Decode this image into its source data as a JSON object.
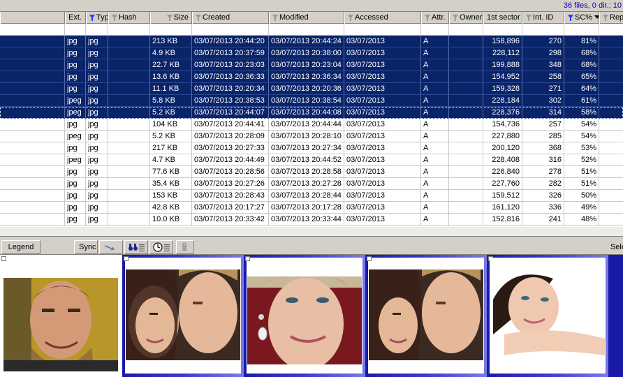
{
  "status": {
    "text": "36 files, 0 dir.; 10"
  },
  "columns": [
    {
      "key": "ext",
      "label": "Ext.",
      "filter": "none"
    },
    {
      "key": "type",
      "label": "Typ",
      "filter": "active"
    },
    {
      "key": "hash",
      "label": "Hash",
      "filter": "inactive"
    },
    {
      "key": "size",
      "label": "Size",
      "filter": "inactive"
    },
    {
      "key": "created",
      "label": "Created",
      "filter": "inactive"
    },
    {
      "key": "modified",
      "label": "Modified",
      "filter": "inactive"
    },
    {
      "key": "accessed",
      "label": "Accessed",
      "filter": "inactive"
    },
    {
      "key": "attr",
      "label": "Attr.",
      "filter": "inactive"
    },
    {
      "key": "owner",
      "label": "Owner",
      "filter": "inactive"
    },
    {
      "key": "sector",
      "label": "1st sector",
      "filter": "none"
    },
    {
      "key": "intid",
      "label": "Int. ID",
      "filter": "inactive"
    },
    {
      "key": "sc",
      "label": "SC%",
      "filter": "active",
      "sorted": "desc"
    },
    {
      "key": "rep",
      "label": "Rep",
      "filter": "inactive"
    }
  ],
  "rows": [
    {
      "ext": "",
      "type": "",
      "hash": "",
      "size": "",
      "created": "",
      "modified": "",
      "accessed": "",
      "attr": "",
      "owner": "",
      "sector": "",
      "intid": "",
      "sc": "",
      "rep": "",
      "selected": false
    },
    {
      "ext": "jpg",
      "type": "jpg",
      "hash": "",
      "size": "213 KB",
      "created": "03/07/2013   20:44:20",
      "modified": "03/07/2013   20:44:24",
      "accessed": "03/07/2013",
      "attr": "A",
      "owner": "",
      "sector": "158,896",
      "intid": "270",
      "sc": "81%",
      "rep": "",
      "selected": true
    },
    {
      "ext": "jpg",
      "type": "jpg",
      "hash": "",
      "size": "4.9 KB",
      "created": "03/07/2013   20:37:59",
      "modified": "03/07/2013   20:38:00",
      "accessed": "03/07/2013",
      "attr": "A",
      "owner": "",
      "sector": "228,112",
      "intid": "298",
      "sc": "68%",
      "rep": "",
      "selected": true
    },
    {
      "ext": "jpg",
      "type": "jpg",
      "hash": "",
      "size": "22.7 KB",
      "created": "03/07/2013   20:23:03",
      "modified": "03/07/2013   20:23:04",
      "accessed": "03/07/2013",
      "attr": "A",
      "owner": "",
      "sector": "199,888",
      "intid": "348",
      "sc": "68%",
      "rep": "",
      "selected": true
    },
    {
      "ext": "jpg",
      "type": "jpg",
      "hash": "",
      "size": "13.6 KB",
      "created": "03/07/2013   20:36:33",
      "modified": "03/07/2013   20:36:34",
      "accessed": "03/07/2013",
      "attr": "A",
      "owner": "",
      "sector": "154,952",
      "intid": "258",
      "sc": "65%",
      "rep": "",
      "selected": true
    },
    {
      "ext": "jpg",
      "type": "jpg",
      "hash": "",
      "size": "11.1 KB",
      "created": "03/07/2013   20:20:34",
      "modified": "03/07/2013   20:20:36",
      "accessed": "03/07/2013",
      "attr": "A",
      "owner": "",
      "sector": "159,328",
      "intid": "271",
      "sc": "64%",
      "rep": "",
      "selected": true
    },
    {
      "ext": "jpeg",
      "type": "jpg",
      "hash": "",
      "size": "5.8 KB",
      "created": "03/07/2013   20:38:53",
      "modified": "03/07/2013   20:38:54",
      "accessed": "03/07/2013",
      "attr": "A",
      "owner": "",
      "sector": "228,184",
      "intid": "302",
      "sc": "61%",
      "rep": "",
      "selected": true
    },
    {
      "ext": "jpeg",
      "type": "jpg",
      "hash": "",
      "size": "5.2 KB",
      "created": "03/07/2013   20:44:07",
      "modified": "03/07/2013   20:44:08",
      "accessed": "03/07/2013",
      "attr": "A",
      "owner": "",
      "sector": "228,376",
      "intid": "314",
      "sc": "58%",
      "rep": "",
      "selected": true,
      "focused": true
    },
    {
      "ext": "jpg",
      "type": "jpg",
      "hash": "",
      "size": "104 KB",
      "created": "03/07/2013   20:44:41",
      "modified": "03/07/2013   20:44:44",
      "accessed": "03/07/2013",
      "attr": "A",
      "owner": "",
      "sector": "154,736",
      "intid": "257",
      "sc": "54%",
      "rep": "",
      "selected": false
    },
    {
      "ext": "jpeg",
      "type": "jpg",
      "hash": "",
      "size": "5.2 KB",
      "created": "03/07/2013   20:28:09",
      "modified": "03/07/2013   20:28:10",
      "accessed": "03/07/2013",
      "attr": "A",
      "owner": "",
      "sector": "227,880",
      "intid": "285",
      "sc": "54%",
      "rep": "",
      "selected": false
    },
    {
      "ext": "jpg",
      "type": "jpg",
      "hash": "",
      "size": "217 KB",
      "created": "03/07/2013   20:27:33",
      "modified": "03/07/2013   20:27:34",
      "accessed": "03/07/2013",
      "attr": "A",
      "owner": "",
      "sector": "200,120",
      "intid": "368",
      "sc": "53%",
      "rep": "",
      "selected": false
    },
    {
      "ext": "jpeg",
      "type": "jpg",
      "hash": "",
      "size": "4.7 KB",
      "created": "03/07/2013   20:44:49",
      "modified": "03/07/2013   20:44:52",
      "accessed": "03/07/2013",
      "attr": "A",
      "owner": "",
      "sector": "228,408",
      "intid": "316",
      "sc": "52%",
      "rep": "",
      "selected": false
    },
    {
      "ext": "jpg",
      "type": "jpg",
      "hash": "",
      "size": "77.6 KB",
      "created": "03/07/2013   20:28:56",
      "modified": "03/07/2013   20:28:58",
      "accessed": "03/07/2013",
      "attr": "A",
      "owner": "",
      "sector": "226,840",
      "intid": "278",
      "sc": "51%",
      "rep": "",
      "selected": false
    },
    {
      "ext": "jpg",
      "type": "jpg",
      "hash": "",
      "size": "35.4 KB",
      "created": "03/07/2013   20:27:26",
      "modified": "03/07/2013   20:27:28",
      "accessed": "03/07/2013",
      "attr": "A",
      "owner": "",
      "sector": "227,760",
      "intid": "282",
      "sc": "51%",
      "rep": "",
      "selected": false
    },
    {
      "ext": "jpg",
      "type": "jpg",
      "hash": "",
      "size": "153 KB",
      "created": "03/07/2013   20:28:43",
      "modified": "03/07/2013   20:28:44",
      "accessed": "03/07/2013",
      "attr": "A",
      "owner": "",
      "sector": "159,512",
      "intid": "326",
      "sc": "50%",
      "rep": "",
      "selected": false
    },
    {
      "ext": "jpg",
      "type": "jpg",
      "hash": "",
      "size": "42.8 KB",
      "created": "03/07/2013   20:17:27",
      "modified": "03/07/2013   20:17:28",
      "accessed": "03/07/2013",
      "attr": "A",
      "owner": "",
      "sector": "161,120",
      "intid": "336",
      "sc": "49%",
      "rep": "",
      "selected": false
    },
    {
      "ext": "jpg",
      "type": "jpg",
      "hash": "",
      "size": "10.0 KB",
      "created": "03/07/2013   20:33:42",
      "modified": "03/07/2013   20:33:44",
      "accessed": "03/07/2013",
      "attr": "A",
      "owner": "",
      "sector": "152,816",
      "intid": "241",
      "sc": "48%",
      "rep": "",
      "selected": false
    },
    {
      "ext": "",
      "type": "",
      "hash": "",
      "size": "",
      "created": "",
      "modified": "",
      "accessed": "",
      "attr": "",
      "owner": "",
      "sector": "",
      "intid": "",
      "sc": "",
      "rep": "",
      "selected": false
    }
  ],
  "toolbar": {
    "legend_label": "Legend",
    "sync_label": "Sync",
    "right_label": "Sele",
    "icons": [
      "sync-arrow-icon",
      "binoculars-list-icon",
      "clock-list-icon",
      "paperclip-icon"
    ]
  },
  "thumbnails": [
    {
      "name": "thumb-man-smiling",
      "selected": true
    },
    {
      "name": "thumb-couple-closeup",
      "selected": true
    },
    {
      "name": "thumb-woman-earring",
      "selected": true
    },
    {
      "name": "thumb-couple-closeup-2",
      "selected": true
    },
    {
      "name": "thumb-woman-lying",
      "selected": true
    }
  ],
  "colors": {
    "selection": "#0a246a",
    "status_text": "#0000c0",
    "filter_active": "#1f3fff",
    "chrome": "#d4d0c8"
  }
}
